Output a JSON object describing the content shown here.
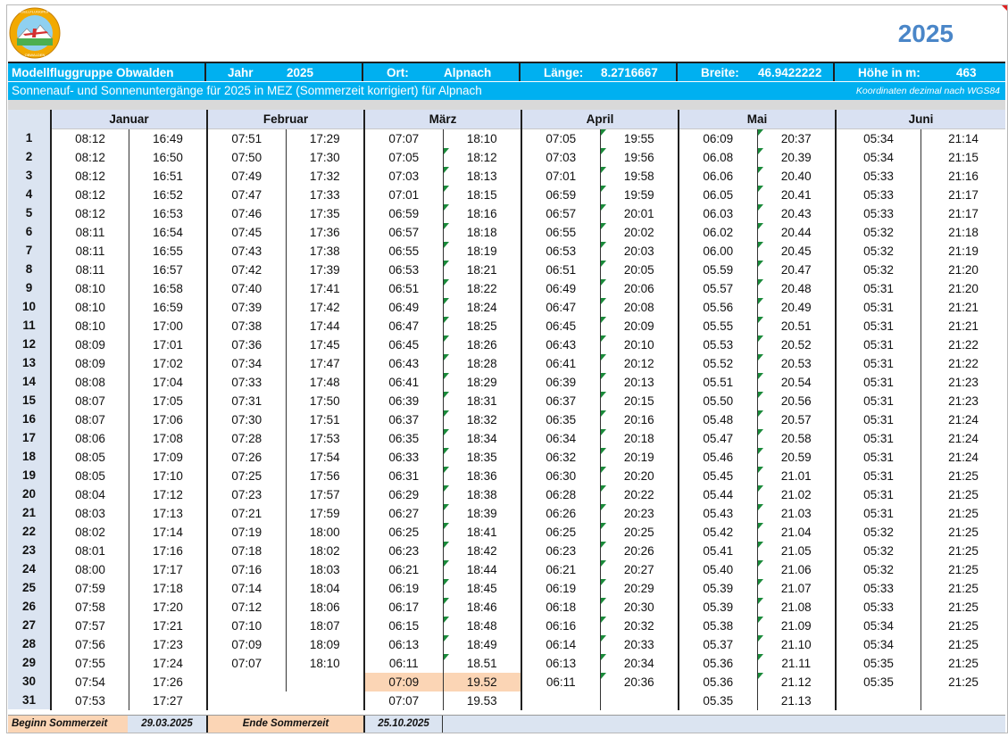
{
  "header": {
    "year": "2025",
    "club": "Modellfluggruppe Obwalden",
    "jahr_label": "Jahr",
    "jahr_value": "2025",
    "ort_label": "Ort:",
    "ort_value": "Alpnach",
    "laenge_label": "Länge:",
    "laenge_value": "8.2716667",
    "breite_label": "Breite:",
    "breite_value": "46.9422222",
    "hoehe_label": "Höhe in m:",
    "hoehe_value": "463",
    "subtitle": "Sonnenauf- und Sonnenuntergänge für 2025 in MEZ (Sommerzeit korrigiert) für Alpnach",
    "coords_note": "Koordinaten dezimal nach WGS84"
  },
  "months": [
    {
      "name": "Januar",
      "rows": [
        [
          "08:12",
          "16:49"
        ],
        [
          "08:12",
          "16:50"
        ],
        [
          "08:12",
          "16:51"
        ],
        [
          "08:12",
          "16:52"
        ],
        [
          "08:12",
          "16:53"
        ],
        [
          "08:11",
          "16:54"
        ],
        [
          "08:11",
          "16:55"
        ],
        [
          "08:11",
          "16:57"
        ],
        [
          "08:10",
          "16:58"
        ],
        [
          "08:10",
          "16:59"
        ],
        [
          "08:10",
          "17:00"
        ],
        [
          "08:09",
          "17:01"
        ],
        [
          "08:09",
          "17:02"
        ],
        [
          "08:08",
          "17:04"
        ],
        [
          "08:07",
          "17:05"
        ],
        [
          "08:07",
          "17:06"
        ],
        [
          "08:06",
          "17:08"
        ],
        [
          "08:05",
          "17:09"
        ],
        [
          "08:05",
          "17:10"
        ],
        [
          "08:04",
          "17:12"
        ],
        [
          "08:03",
          "17:13"
        ],
        [
          "08:02",
          "17:14"
        ],
        [
          "08:01",
          "17:16"
        ],
        [
          "08:00",
          "17:17"
        ],
        [
          "07:59",
          "17:18"
        ],
        [
          "07:58",
          "17:20"
        ],
        [
          "07:57",
          "17:21"
        ],
        [
          "07:56",
          "17:23"
        ],
        [
          "07:55",
          "17:24"
        ],
        [
          "07:54",
          "17:26"
        ],
        [
          "07:53",
          "17:27"
        ]
      ]
    },
    {
      "name": "Februar",
      "rows": [
        [
          "07:51",
          "17:29"
        ],
        [
          "07:50",
          "17:30"
        ],
        [
          "07:49",
          "17:32"
        ],
        [
          "07:47",
          "17:33"
        ],
        [
          "07:46",
          "17:35"
        ],
        [
          "07:45",
          "17:36"
        ],
        [
          "07:43",
          "17:38"
        ],
        [
          "07:42",
          "17:39"
        ],
        [
          "07:40",
          "17:41"
        ],
        [
          "07:39",
          "17:42"
        ],
        [
          "07:38",
          "17:44"
        ],
        [
          "07:36",
          "17:45"
        ],
        [
          "07:34",
          "17:47"
        ],
        [
          "07:33",
          "17:48"
        ],
        [
          "07:31",
          "17:50"
        ],
        [
          "07:30",
          "17:51"
        ],
        [
          "07:28",
          "17:53"
        ],
        [
          "07:26",
          "17:54"
        ],
        [
          "07:25",
          "17:56"
        ],
        [
          "07:23",
          "17:57"
        ],
        [
          "07:21",
          "17:59"
        ],
        [
          "07:19",
          "18:00"
        ],
        [
          "07:18",
          "18:02"
        ],
        [
          "07:16",
          "18:03"
        ],
        [
          "07:14",
          "18:04"
        ],
        [
          "07:12",
          "18:06"
        ],
        [
          "07:10",
          "18:07"
        ],
        [
          "07:09",
          "18:09"
        ],
        [
          "07:07",
          "18:10"
        ],
        [
          "",
          ""
        ],
        [
          "",
          ""
        ]
      ]
    },
    {
      "name": "März",
      "rows": [
        [
          "07:07",
          "18:10"
        ],
        [
          "07:05",
          "18:12"
        ],
        [
          "07:03",
          "18:13"
        ],
        [
          "07:01",
          "18:15"
        ],
        [
          "06:59",
          "18:16"
        ],
        [
          "06:57",
          "18:18"
        ],
        [
          "06:55",
          "18:19"
        ],
        [
          "06:53",
          "18:21"
        ],
        [
          "06:51",
          "18:22"
        ],
        [
          "06:49",
          "18:24"
        ],
        [
          "06:47",
          "18:25"
        ],
        [
          "06:45",
          "18:26"
        ],
        [
          "06:43",
          "18:28"
        ],
        [
          "06:41",
          "18:29"
        ],
        [
          "06:39",
          "18:31"
        ],
        [
          "06:37",
          "18:32"
        ],
        [
          "06:35",
          "18:34"
        ],
        [
          "06:33",
          "18:35"
        ],
        [
          "06:31",
          "18:36"
        ],
        [
          "06:29",
          "18:38"
        ],
        [
          "06:27",
          "18:39"
        ],
        [
          "06:25",
          "18:41"
        ],
        [
          "06:23",
          "18:42"
        ],
        [
          "06:21",
          "18:44"
        ],
        [
          "06:19",
          "18:45"
        ],
        [
          "06:17",
          "18:46"
        ],
        [
          "06:15",
          "18:48"
        ],
        [
          "06:13",
          "18:49"
        ],
        [
          "06:11",
          "18.51"
        ],
        [
          "07:09",
          "19.52"
        ],
        [
          "07:07",
          "19.53"
        ]
      ]
    },
    {
      "name": "April",
      "rows": [
        [
          "07:05",
          "19:55"
        ],
        [
          "07:03",
          "19:56"
        ],
        [
          "07:01",
          "19:58"
        ],
        [
          "06:59",
          "19:59"
        ],
        [
          "06:57",
          "20:01"
        ],
        [
          "06:55",
          "20:02"
        ],
        [
          "06:53",
          "20:03"
        ],
        [
          "06:51",
          "20:05"
        ],
        [
          "06:49",
          "20:06"
        ],
        [
          "06:47",
          "20:08"
        ],
        [
          "06:45",
          "20:09"
        ],
        [
          "06:43",
          "20:10"
        ],
        [
          "06:41",
          "20:12"
        ],
        [
          "06:39",
          "20:13"
        ],
        [
          "06:37",
          "20:15"
        ],
        [
          "06:35",
          "20:16"
        ],
        [
          "06:34",
          "20:18"
        ],
        [
          "06:32",
          "20:19"
        ],
        [
          "06:30",
          "20:20"
        ],
        [
          "06:28",
          "20:22"
        ],
        [
          "06:26",
          "20:23"
        ],
        [
          "06:25",
          "20:25"
        ],
        [
          "06:23",
          "20:26"
        ],
        [
          "06:21",
          "20:27"
        ],
        [
          "06:19",
          "20:29"
        ],
        [
          "06:18",
          "20:30"
        ],
        [
          "06:16",
          "20:32"
        ],
        [
          "06:14",
          "20:33"
        ],
        [
          "06:13",
          "20:34"
        ],
        [
          "06:11",
          "20:36"
        ],
        [
          "",
          ""
        ]
      ]
    },
    {
      "name": "Mai",
      "rows": [
        [
          "06:09",
          "20:37"
        ],
        [
          "06.08",
          "20.39"
        ],
        [
          "06.06",
          "20.40"
        ],
        [
          "06.05",
          "20.41"
        ],
        [
          "06.03",
          "20.43"
        ],
        [
          "06.02",
          "20.44"
        ],
        [
          "06.00",
          "20.45"
        ],
        [
          "05.59",
          "20.47"
        ],
        [
          "05.57",
          "20.48"
        ],
        [
          "05.56",
          "20.49"
        ],
        [
          "05.55",
          "20.51"
        ],
        [
          "05.53",
          "20.52"
        ],
        [
          "05.52",
          "20.53"
        ],
        [
          "05.51",
          "20.54"
        ],
        [
          "05.50",
          "20.56"
        ],
        [
          "05.48",
          "20.57"
        ],
        [
          "05.47",
          "20.58"
        ],
        [
          "05.46",
          "20.59"
        ],
        [
          "05.45",
          "21.01"
        ],
        [
          "05.44",
          "21.02"
        ],
        [
          "05.43",
          "21.03"
        ],
        [
          "05.42",
          "21.04"
        ],
        [
          "05.41",
          "21.05"
        ],
        [
          "05.40",
          "21.06"
        ],
        [
          "05.39",
          "21.07"
        ],
        [
          "05.39",
          "21.08"
        ],
        [
          "05.38",
          "21.09"
        ],
        [
          "05.37",
          "21.10"
        ],
        [
          "05.36",
          "21.11"
        ],
        [
          "05.36",
          "21.12"
        ],
        [
          "05.35",
          "21.13"
        ]
      ]
    },
    {
      "name": "Juni",
      "rows": [
        [
          "05:34",
          "21:14"
        ],
        [
          "05:34",
          "21:15"
        ],
        [
          "05:33",
          "21:16"
        ],
        [
          "05:33",
          "21:17"
        ],
        [
          "05:33",
          "21:17"
        ],
        [
          "05:32",
          "21:18"
        ],
        [
          "05:32",
          "21:19"
        ],
        [
          "05:32",
          "21:20"
        ],
        [
          "05:31",
          "21:20"
        ],
        [
          "05:31",
          "21:21"
        ],
        [
          "05:31",
          "21:21"
        ],
        [
          "05:31",
          "21:22"
        ],
        [
          "05:31",
          "21:22"
        ],
        [
          "05:31",
          "21:23"
        ],
        [
          "05:31",
          "21:23"
        ],
        [
          "05:31",
          "21:24"
        ],
        [
          "05:31",
          "21:24"
        ],
        [
          "05:31",
          "21:24"
        ],
        [
          "05:31",
          "21:25"
        ],
        [
          "05:31",
          "21:25"
        ],
        [
          "05:31",
          "21:25"
        ],
        [
          "05:32",
          "21:25"
        ],
        [
          "05:32",
          "21:25"
        ],
        [
          "05:32",
          "21:25"
        ],
        [
          "05:33",
          "21:25"
        ],
        [
          "05:33",
          "21:25"
        ],
        [
          "05:34",
          "21:25"
        ],
        [
          "05:34",
          "21:25"
        ],
        [
          "05:35",
          "21:25"
        ],
        [
          "05:35",
          "21:25"
        ],
        [
          "",
          ""
        ]
      ]
    }
  ],
  "footer": {
    "beginn_label": "Beginn Sommerzeit",
    "beginn_date": "29.03.2025",
    "ende_label": "Ende Sommerzeit",
    "ende_date": "25.10.2025"
  },
  "colors": {
    "accent": "#00b0f0",
    "title": "#4a86c8",
    "highlight": "#fbd5b5",
    "day_bg": "#dbe4f1",
    "flag": "#1a8a3a"
  },
  "logo_icon": "model-airplane-club-logo"
}
